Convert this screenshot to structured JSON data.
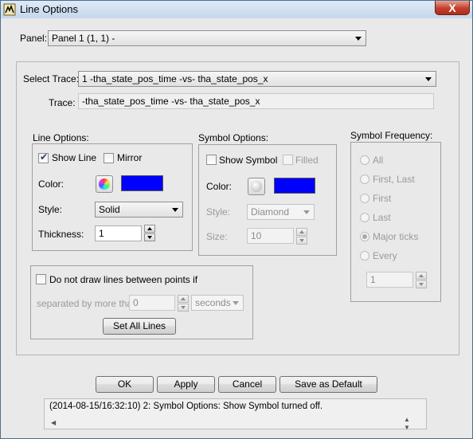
{
  "window": {
    "title": "Line Options",
    "close_label": "X"
  },
  "panel": {
    "label": "Panel:",
    "selected": "Panel 1 (1, 1) -"
  },
  "trace": {
    "select_label": "Select Trace:",
    "selected": "1 -tha_state_pos_time -vs- tha_state_pos_x",
    "trace_label": "Trace:",
    "trace_value": "-tha_state_pos_time -vs- tha_state_pos_x"
  },
  "line_options": {
    "title": "Line Options:",
    "show_line_label": "Show Line",
    "show_line_checked": true,
    "mirror_label": "Mirror",
    "mirror_checked": false,
    "color_label": "Color:",
    "color": "#0000ff",
    "style_label": "Style:",
    "style_value": "Solid",
    "thickness_label": "Thickness:",
    "thickness_value": "1"
  },
  "symbol_options": {
    "title": "Symbol Options:",
    "show_symbol_label": "Show Symbol",
    "show_symbol_checked": false,
    "filled_label": "Filled",
    "filled_checked": false,
    "color_label": "Color:",
    "color": "#0000ff",
    "style_label": "Style:",
    "style_value": "Diamond",
    "size_label": "Size:",
    "size_value": "10"
  },
  "symbol_frequency": {
    "title": "Symbol Frequency:",
    "options": [
      "All",
      "First, Last",
      "First",
      "Last",
      "Major ticks",
      "Every"
    ],
    "selected": "Major ticks",
    "every_value": "1"
  },
  "gaps": {
    "checkbox_label": "Do not draw lines between points if",
    "checked": false,
    "separated_label": "separated by more than",
    "separated_value": "0",
    "unit": "seconds",
    "set_all_label": "Set All Lines"
  },
  "buttons": {
    "ok": "OK",
    "apply": "Apply",
    "cancel": "Cancel",
    "save_default": "Save as Default"
  },
  "status": {
    "message": "(2014-08-15/16:32:10) 2: Symbol Options: Show Symbol turned off."
  }
}
